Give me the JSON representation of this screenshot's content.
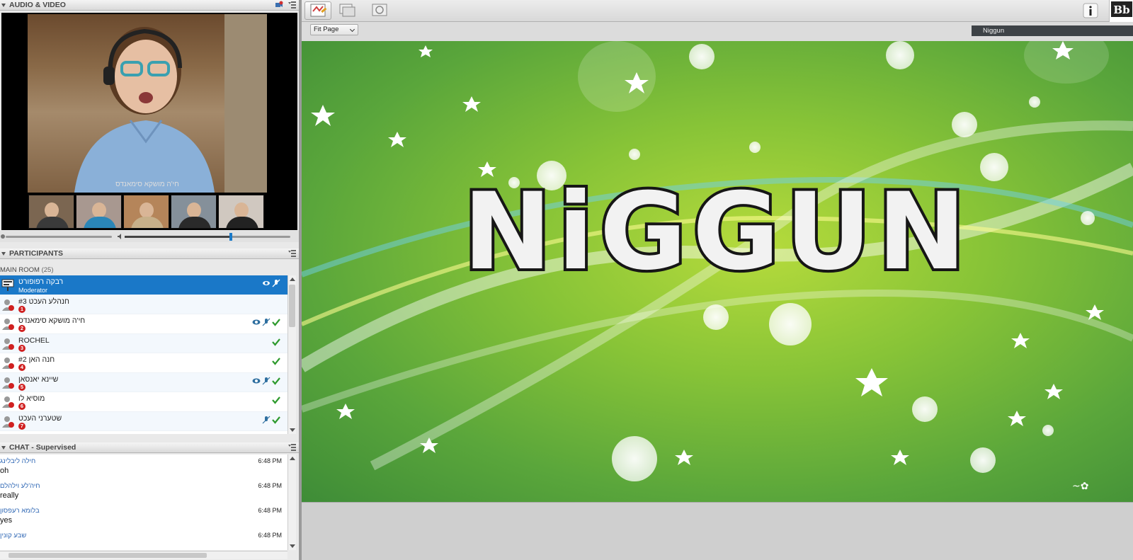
{
  "av_panel": {
    "title": "AUDIO & VIDEO",
    "video_caption": "חי'ה מושקא סימאנדס"
  },
  "participants_panel": {
    "title": "PARTICIPANTS",
    "room_name": "MAIN ROOM",
    "room_count": "(25)",
    "participants": [
      {
        "name": "רבקה רפופורט",
        "role": "Moderator",
        "number": "",
        "selected": true
      },
      {
        "name": "#3 חנהלע העכט",
        "role": "",
        "number": "1",
        "selected": false
      },
      {
        "name": "חי'ה מושקא סימאנדס",
        "role": "",
        "number": "2",
        "selected": false
      },
      {
        "name": "ROCHEL",
        "role": "",
        "number": "3",
        "selected": false
      },
      {
        "name": "#2 חנה האן",
        "role": "",
        "number": "4",
        "selected": false
      },
      {
        "name": "שיינא יאנסאן",
        "role": "",
        "number": "5",
        "selected": false
      },
      {
        "name": "מוסיא לו",
        "role": "",
        "number": "6",
        "selected": false
      },
      {
        "name": "שטערני העכט",
        "role": "",
        "number": "7",
        "selected": false
      }
    ]
  },
  "chat_panel": {
    "title": "CHAT - Supervised",
    "messages": [
      {
        "sender": "חילה ליבלינג",
        "time": "6:48 PM",
        "text": "oh"
      },
      {
        "sender": "חיה'לע וילהלם",
        "time": "6:48 PM",
        "text": "really"
      },
      {
        "sender": "בלומא רעפסון",
        "time": "6:48 PM",
        "text": "yes"
      },
      {
        "sender": "שבע קונין",
        "time": "6:48 PM",
        "text": ""
      }
    ]
  },
  "whiteboard": {
    "zoom_label": "Fit Page",
    "page_name": "Niggun",
    "slide_title": "NiGGUN",
    "logo_text": "Bb"
  },
  "colors": {
    "selection_blue": "#1a78c8",
    "status_green": "#2e9a2e",
    "badge_red": "#d02020",
    "chat_sender_blue": "#2d66b4"
  }
}
